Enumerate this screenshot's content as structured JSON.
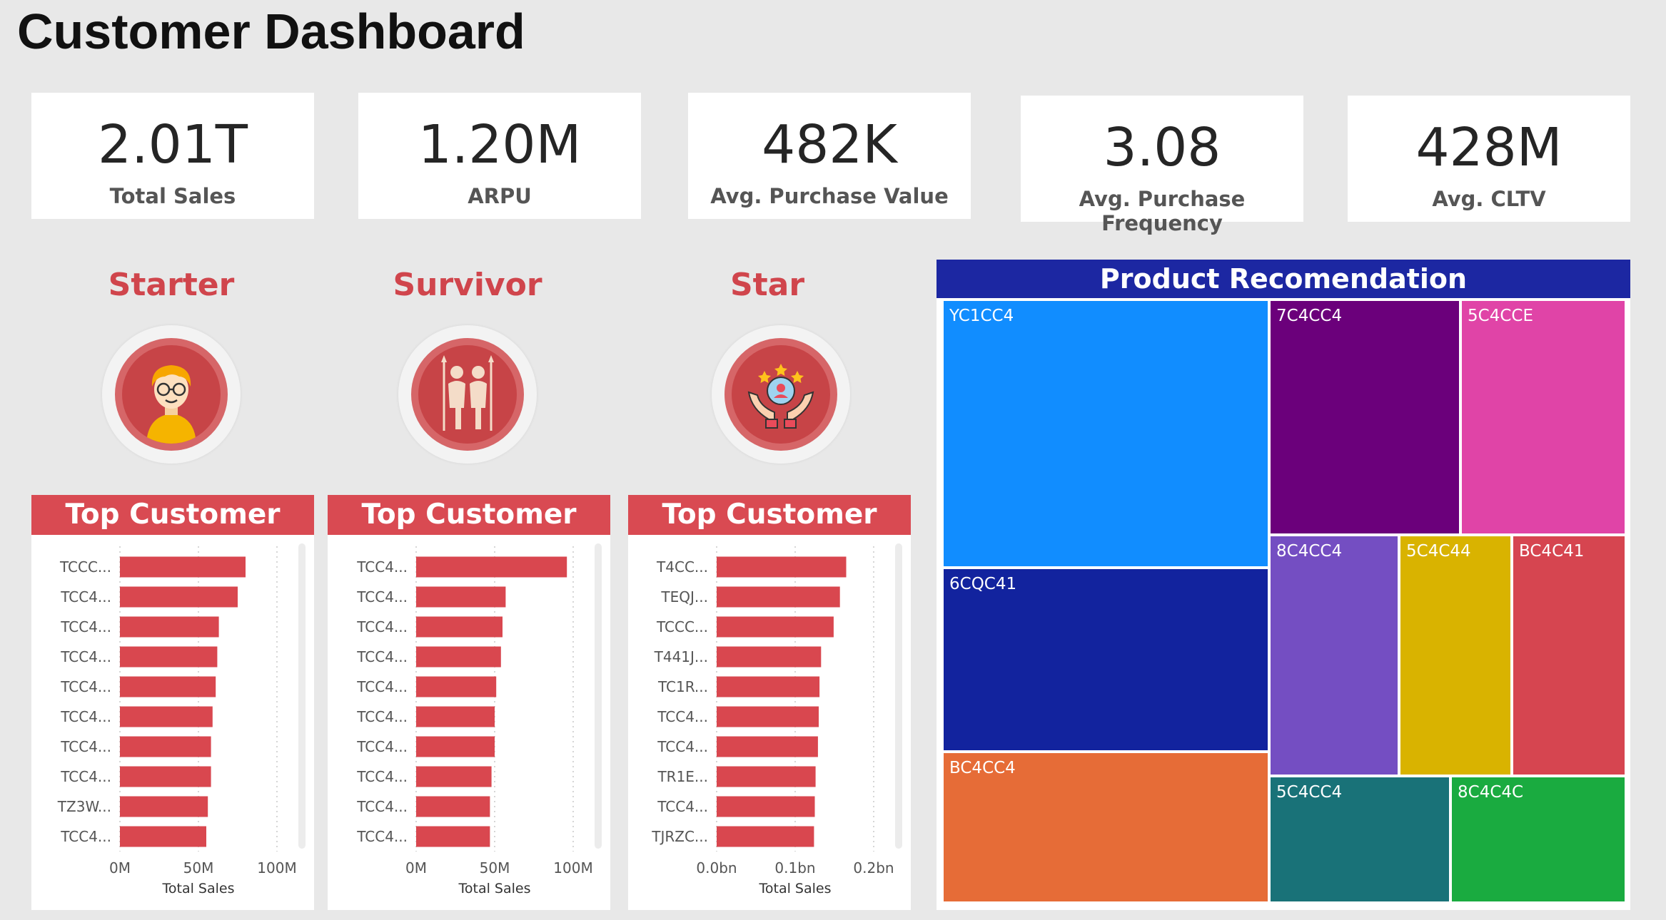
{
  "page": {
    "title": "Customer Dashboard"
  },
  "kpis": [
    {
      "value": "2.01T",
      "label": "Total Sales"
    },
    {
      "value": "1.20M",
      "label": "ARPU"
    },
    {
      "value": "482K",
      "label": "Avg. Purchase Value"
    },
    {
      "value": "3.08",
      "label": "Avg. Purchase Frequency"
    },
    {
      "value": "428M",
      "label": "Avg. CLTV"
    }
  ],
  "segments": [
    {
      "title": "Starter",
      "icon": "user-avatar-icon",
      "card_title": "Top Customer"
    },
    {
      "title": "Survivor",
      "icon": "survivor-couple-icon",
      "card_title": "Top Customer"
    },
    {
      "title": "Star",
      "icon": "star-customer-hands-icon",
      "card_title": "Top Customer"
    }
  ],
  "colors": {
    "accent_red": "#d94a52",
    "bar_red": "#d9474f",
    "header_blue": "#1c27a2"
  },
  "chart_data": [
    {
      "type": "bar",
      "orientation": "horizontal",
      "categories": [
        "TCCC...",
        "TCC4...",
        "TCC4...",
        "TCC4...",
        "TCC4...",
        "TCC4...",
        "TCC4...",
        "TCC4...",
        "TZ3W...",
        "TCC4..."
      ],
      "values": [
        80,
        75,
        63,
        62,
        61,
        59,
        58,
        58,
        56,
        55
      ],
      "xlabel": "Total Sales",
      "xlim": [
        0,
        100
      ],
      "xticks": [
        0,
        50,
        100
      ],
      "xtick_labels": [
        "0M",
        "50M",
        "100M"
      ],
      "grid": true
    },
    {
      "type": "bar",
      "orientation": "horizontal",
      "categories": [
        "TCC4...",
        "TCC4...",
        "TCC4...",
        "TCC4...",
        "TCC4...",
        "TCC4...",
        "TCC4...",
        "TCC4...",
        "TCC4...",
        "TCC4..."
      ],
      "values": [
        96,
        57,
        55,
        54,
        51,
        50,
        50,
        48,
        47,
        47
      ],
      "xlabel": "Total Sales",
      "xlim": [
        0,
        100
      ],
      "xticks": [
        0,
        50,
        100
      ],
      "xtick_labels": [
        "0M",
        "50M",
        "100M"
      ],
      "grid": true
    },
    {
      "type": "bar",
      "orientation": "horizontal",
      "categories": [
        "T4CC...",
        "TEQJ...",
        "TCCC...",
        "T441J...",
        "TC1R...",
        "TCC4...",
        "TCC4...",
        "TR1E...",
        "TCC4...",
        "TJRZC..."
      ],
      "values": [
        0.165,
        0.157,
        0.149,
        0.133,
        0.131,
        0.13,
        0.129,
        0.126,
        0.125,
        0.124
      ],
      "xlabel": "Total Sales",
      "xlim": [
        0,
        0.2
      ],
      "xticks": [
        0,
        0.1,
        0.2
      ],
      "xtick_labels": [
        "0.0bn",
        "0.1bn",
        "0.2bn"
      ],
      "grid": true
    }
  ],
  "treemap": {
    "title": "Product Recomendation",
    "tiles": [
      {
        "label": "YC1CC4",
        "color": "#118dff"
      },
      {
        "label": "7C4CC4",
        "color": "#6b007b"
      },
      {
        "label": "5C4CCE",
        "color": "#e044a7"
      },
      {
        "label": "6CQC41",
        "color": "#12239e"
      },
      {
        "label": "8C4CC4",
        "color": "#744ec2"
      },
      {
        "label": "5C4C44",
        "color": "#d9b300"
      },
      {
        "label": "BC4C41",
        "color": "#d64550"
      },
      {
        "label": "BC4CC4",
        "color": "#e66c37"
      },
      {
        "label": "5C4CC4",
        "color": "#197278"
      },
      {
        "label": "8C4C4C",
        "color": "#1aab40"
      }
    ]
  }
}
